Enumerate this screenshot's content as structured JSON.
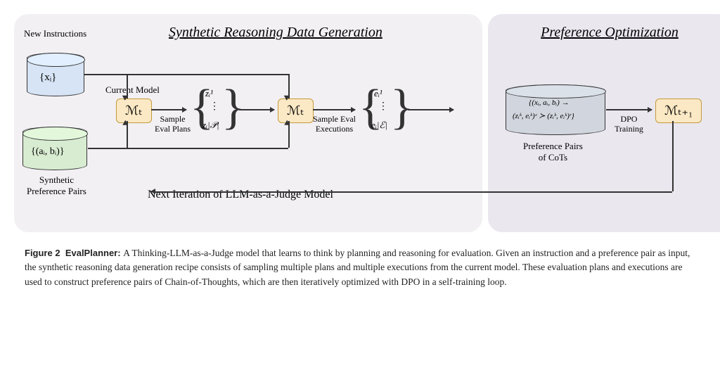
{
  "diagram": {
    "panel_left_title": "Synthetic Reasoning Data Generation",
    "panel_right_title": "Preference Optimization",
    "labels": {
      "new_instructions": "New Instructions",
      "current_model": "Current Model",
      "synthetic_pairs": "Synthetic\nPreference Pairs",
      "sample_plans": "Sample\nEval Plans",
      "sample_exec": "Sample Eval\nExecutions",
      "pref_pairs_cots": "Preference Pairs\nof CoTs",
      "dpo": "DPO\nTraining",
      "next_iteration": "Next Iteration of LLM-as-a-Judge Model"
    },
    "math": {
      "xi": "{xᵢ}",
      "ai_bi": "{(aᵢ, bᵢ)}",
      "mt": "ℳₜ",
      "mt1": "ℳₜ₊₁",
      "z1": "zᵢ¹",
      "zP": "zᵢ|𝒫|",
      "e1": "eᵢ¹",
      "eE": "eᵢ|ℰ|",
      "pref_formula_top": "{(xᵢ, aᵢ, bᵢ) →",
      "pref_formula_bot": "(zᵢᵏ, eᵢᵏ)ᶜ ≻ (zᵢᵏ, eᵢᵏ)ʳ}"
    }
  },
  "caption": {
    "fig_label": "Figure 2",
    "title": "EvalPlanner:",
    "body": "A Thinking-LLM-as-a-Judge model that learns to think by planning and reasoning for evaluation. Given an instruction and a preference pair as input, the synthetic reasoning data generation recipe consists of sampling multiple plans and multiple executions from the current model. These evaluation plans and executions are used to construct preference pairs of Chain-of-Thoughts, which are then iteratively optimized with DPO in a self-training loop."
  }
}
